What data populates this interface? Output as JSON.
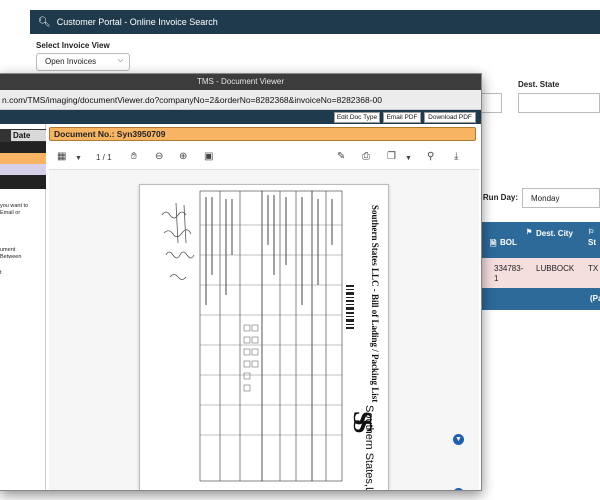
{
  "portal": {
    "title": "Customer Portal - Online Invoice Search",
    "select_view_label": "Select Invoice View",
    "invoice_view_value": "Open Invoices",
    "dest_state_label": "Dest. State",
    "run_day_label": "Run Day:",
    "run_day_prefix": ":",
    "run_day_value": "Monday",
    "table": {
      "headers": [
        "BOL",
        "Dest. City",
        "St"
      ],
      "row": [
        "334783-1",
        "LUBBOCK",
        "TX"
      ],
      "footer": "(Pa"
    }
  },
  "viewer": {
    "window_title": "TMS - Document Viewer",
    "url": "n.com/TMS/imaging/documentViewer.do?companyNo=2&orderNo=8282368&invoiceNo=8282368-00",
    "buttons": [
      "Edit Doc Type",
      "Email PDF",
      "Download PDF"
    ],
    "left_panel": {
      "date_header": "Date",
      "note": [
        "you want to",
        "Email or"
      ],
      "text2": [
        "ument",
        "Between"
      ],
      "text3": [
        "t"
      ]
    },
    "doc_number": "Document No.: Syn3950709",
    "page_count": "1 / 1",
    "doc_title": "Southern States LLC - Bill of Lading / Packing List",
    "company_name": "Southern States,LLC"
  },
  "colors": {
    "portal_header": "#1f3a4d",
    "table_header": "#2d6a9a",
    "row_highlight": "#f4dede",
    "doc_number_bar": "#f7b463",
    "nav_button": "#1e5fb3"
  }
}
